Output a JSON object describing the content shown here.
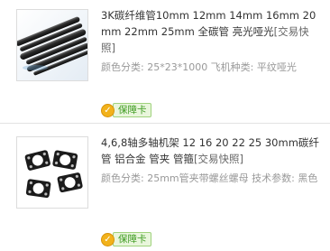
{
  "orders": [
    {
      "title": "3K碳纤维管10mm 12mm 14mm 16mm 20mm 22mm 25mm 全碳管 亮光哑光",
      "snapshot": "[交易快照]",
      "attributes": "颜色分类: 25*23*1000 飞机种类: 平纹哑光",
      "badge_icon": "✓",
      "badge_label": "保障卡",
      "thumb_icon": "carbon-fiber-tubes-image"
    },
    {
      "title": "4,6,8轴多轴机架 12 16 20 22 25 30mm碳纤管 铝合金 管夹 管箍",
      "snapshot": "[交易快照]",
      "attributes": "颜色分类: 25mm管夹带螺丝螺母 技术参数: 黑色",
      "badge_icon": "✓",
      "badge_label": "保障卡",
      "thumb_icon": "tube-clamps-image"
    }
  ],
  "colors": {
    "title": "#333333",
    "muted": "#999999",
    "badge_green": "#3c9a1f",
    "badge_gold": "#f2b21b"
  }
}
